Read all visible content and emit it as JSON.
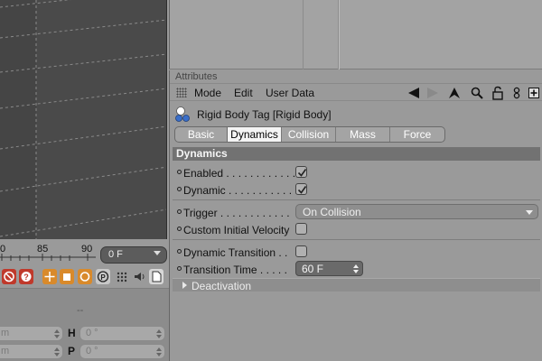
{
  "timeline": {
    "ticks": [
      "0",
      "85",
      "90"
    ],
    "frame_value": "0 F"
  },
  "coords": {
    "separator": "--",
    "rows": [
      {
        "unit": "m",
        "axis": "H",
        "angle": "0 °"
      },
      {
        "unit": "m",
        "axis": "P",
        "angle": "0 °"
      }
    ]
  },
  "attributes": {
    "panel_title": "Attributes",
    "menu": [
      "Mode",
      "Edit",
      "User Data"
    ],
    "object_title": "Rigid Body Tag [Rigid Body]",
    "tabs": [
      {
        "label": "Basic",
        "active": false
      },
      {
        "label": "Dynamics",
        "active": true
      },
      {
        "label": "Collision",
        "active": false
      },
      {
        "label": "Mass",
        "active": false
      },
      {
        "label": "Force",
        "active": false
      }
    ],
    "section_title": "Dynamics",
    "params": {
      "enabled": {
        "label": "Enabled . . . . . . . . . . . .",
        "checked": true
      },
      "dynamic": {
        "label": "Dynamic . . . . . . . . . . . .",
        "checked": true
      },
      "trigger": {
        "label": "Trigger . . . . . . . . . . . .",
        "value": "On Collision"
      },
      "custom_velocity": {
        "label": "Custom Initial Velocity",
        "checked": false
      },
      "dynamic_transition": {
        "label": "Dynamic Transition . .",
        "checked": false
      },
      "transition_time": {
        "label": "Transition Time . . . . .",
        "value": "60 F"
      }
    },
    "deactivation_label": "Deactivation"
  },
  "colors": {
    "panel_bg": "#9a9a9a",
    "viewport_bg": "#4a4a4a",
    "section_header": "#727272",
    "active_tab": "#f4f4f4"
  }
}
